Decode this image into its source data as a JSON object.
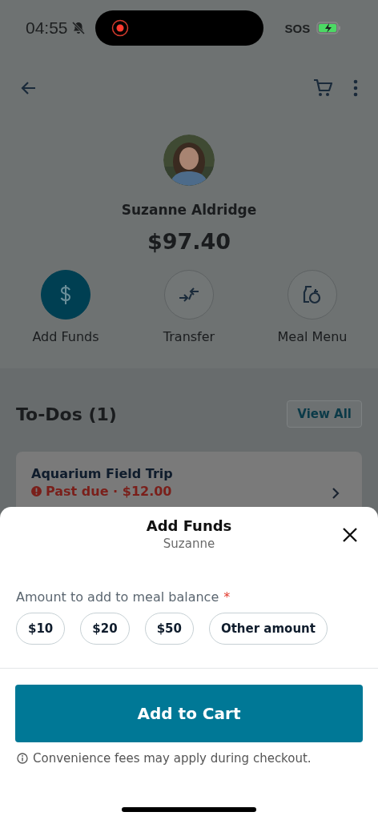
{
  "status_bar": {
    "time": "04:55",
    "sos": "SOS"
  },
  "profile": {
    "name": "Suzanne Aldridge",
    "balance": "$97.40"
  },
  "actions": [
    {
      "label": "Add Funds",
      "kind": "dollar",
      "selected": true
    },
    {
      "label": "Transfer",
      "kind": "transfer",
      "selected": false
    },
    {
      "label": "Meal Menu",
      "kind": "meal",
      "selected": false
    }
  ],
  "todos": {
    "title": "To-Dos (1)",
    "view_all": "View All",
    "items": [
      {
        "title": "Aquarium Field Trip",
        "status": "Past due · $12.00"
      }
    ]
  },
  "sheet": {
    "title": "Add Funds",
    "subtitle": "Suzanne",
    "field_label": "Amount to add to meal balance",
    "required_mark": "*",
    "amounts": [
      {
        "label": "$10",
        "selected": false
      },
      {
        "label": "$20",
        "selected": false
      },
      {
        "label": "$50",
        "selected": false
      },
      {
        "label": "Other amount",
        "selected": false
      }
    ],
    "button": "Add to Cart",
    "note": "Convenience fees may apply during checkout."
  }
}
